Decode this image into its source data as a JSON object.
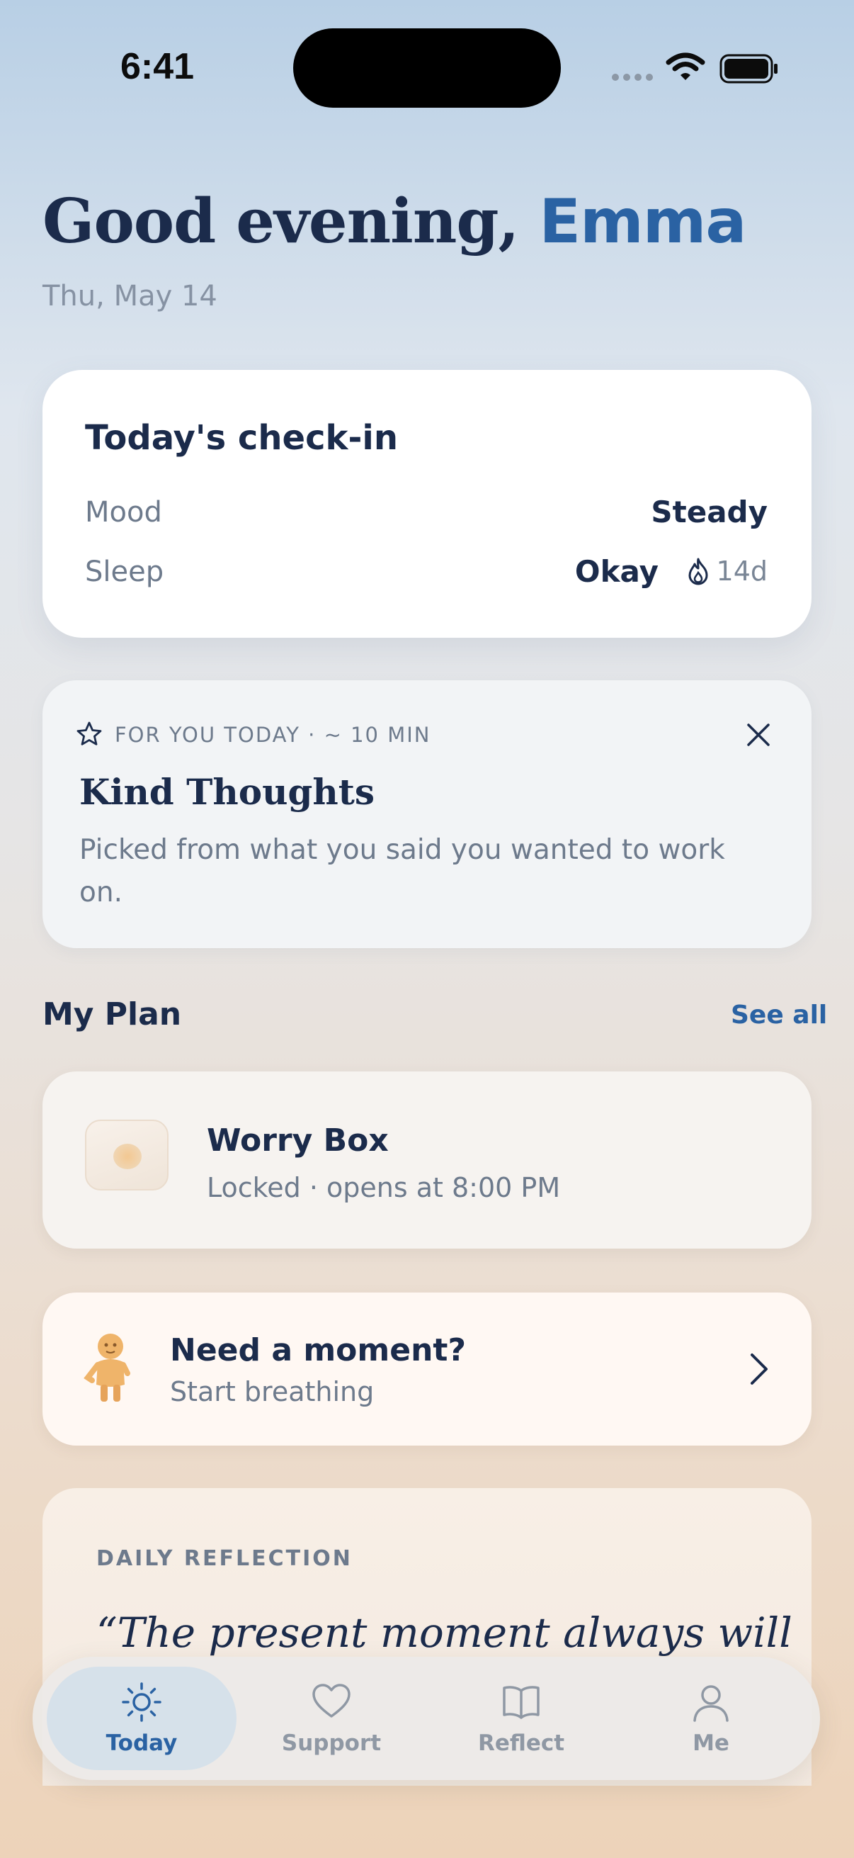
{
  "status_bar": {
    "time": "6:41"
  },
  "greeting": {
    "prefix": "Good evening,",
    "name": "Emma",
    "date": "Thu, May 14"
  },
  "checkin": {
    "title": "Today's check-in",
    "mood_label": "Mood",
    "mood_value": "Steady",
    "sleep_label": "Sleep",
    "sleep_value": "Okay",
    "streak": "14d"
  },
  "for_you": {
    "kicker": "FOR YOU TODAY · ~ 10 MIN",
    "title": "Kind Thoughts",
    "description": "Picked from what you said you wanted to work on."
  },
  "my_plan": {
    "title": "My Plan",
    "see_all": "See all",
    "worry_box": {
      "title": "Worry Box",
      "subtitle": "Locked · opens at 8:00 PM"
    },
    "need_moment": {
      "title": "Need a moment?",
      "subtitle": "Start breathing"
    }
  },
  "daily_reflection": {
    "kicker": "DAILY REFLECTION",
    "quote": "“The present moment always will"
  },
  "tab_bar": {
    "tabs": [
      {
        "label": "Today",
        "icon": "sun-icon",
        "active": true
      },
      {
        "label": "Support",
        "icon": "heart-icon",
        "active": false
      },
      {
        "label": "Reflect",
        "icon": "book-icon",
        "active": false
      },
      {
        "label": "Me",
        "icon": "person-icon",
        "active": false
      }
    ]
  },
  "colors": {
    "accent": "#2a62a3",
    "text_dark": "#1b2b4b",
    "text_muted": "#6d7a8c"
  }
}
